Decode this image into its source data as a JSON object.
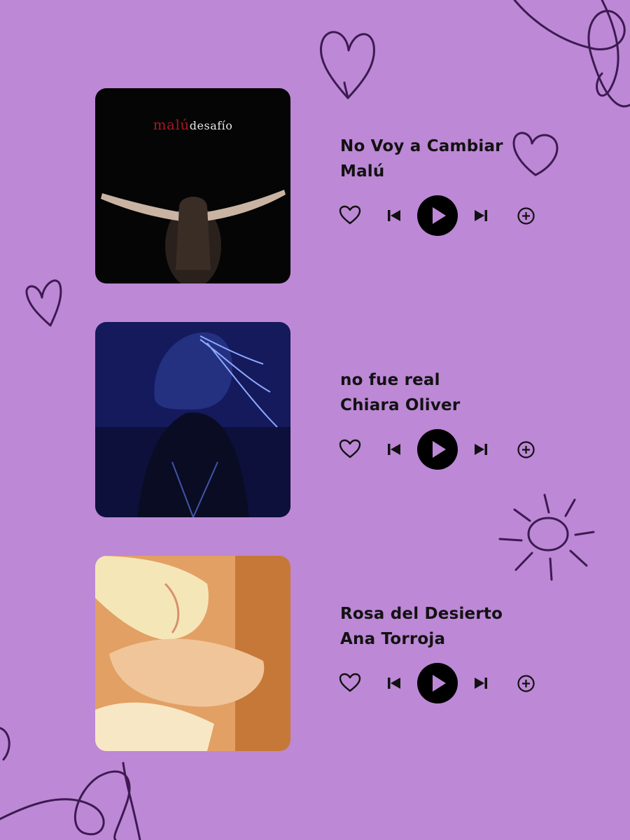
{
  "theme": {
    "background": "#bd88d6",
    "doodle_color": "#3d1a52",
    "control_color": "#111111"
  },
  "tracks": [
    {
      "title": "No Voy a Cambiar",
      "artist": "Malú",
      "cover_text_artist": "malú",
      "cover_text_album": "desafío",
      "cover_description_icon": "album-cover-art"
    },
    {
      "title": "no fue real",
      "artist": "Chiara Oliver",
      "cover_description_icon": "album-cover-art"
    },
    {
      "title": "Rosa del Desierto",
      "artist": "Ana Torroja",
      "cover_description_icon": "album-cover-art"
    }
  ],
  "controls": {
    "like_icon": "heart-outline-icon",
    "previous_icon": "skip-previous-icon",
    "play_icon": "play-icon",
    "next_icon": "skip-next-icon",
    "add_icon": "plus-circle-icon"
  }
}
